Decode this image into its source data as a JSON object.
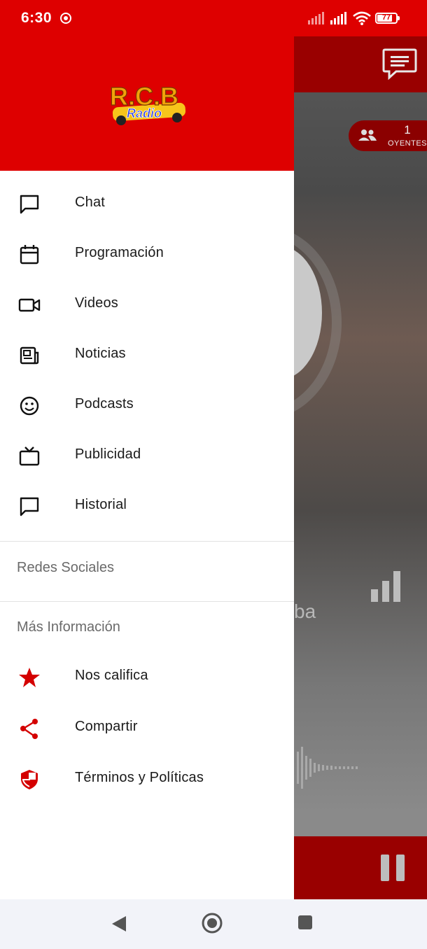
{
  "status_bar": {
    "time": "6:30",
    "battery": "77"
  },
  "drawer": {
    "logo_text": "R.C.B Radio",
    "menu_items": [
      {
        "label": "Chat",
        "icon": "chat-bubble-icon"
      },
      {
        "label": "Programación",
        "icon": "calendar-icon"
      },
      {
        "label": "Videos",
        "icon": "video-camera-icon"
      },
      {
        "label": "Noticias",
        "icon": "newspaper-icon"
      },
      {
        "label": "Podcasts",
        "icon": "smiley-icon"
      },
      {
        "label": "Publicidad",
        "icon": "tv-icon"
      },
      {
        "label": "Historial",
        "icon": "chat-bubble-icon"
      }
    ],
    "social_title": "Redes Sociales",
    "info_title": "Más Información",
    "info_items": [
      {
        "label": "Nos califica",
        "icon": "star-icon"
      },
      {
        "label": "Compartir",
        "icon": "share-icon"
      },
      {
        "label": "Términos y Políticas",
        "icon": "shield-icon"
      }
    ]
  },
  "background_app": {
    "listeners_count": "1",
    "listeners_label": "OYENTES",
    "partial_text": "ba"
  },
  "colors": {
    "brand_red": "#de0000",
    "dark_red": "#990000",
    "accent_icon_red": "#d40000"
  }
}
